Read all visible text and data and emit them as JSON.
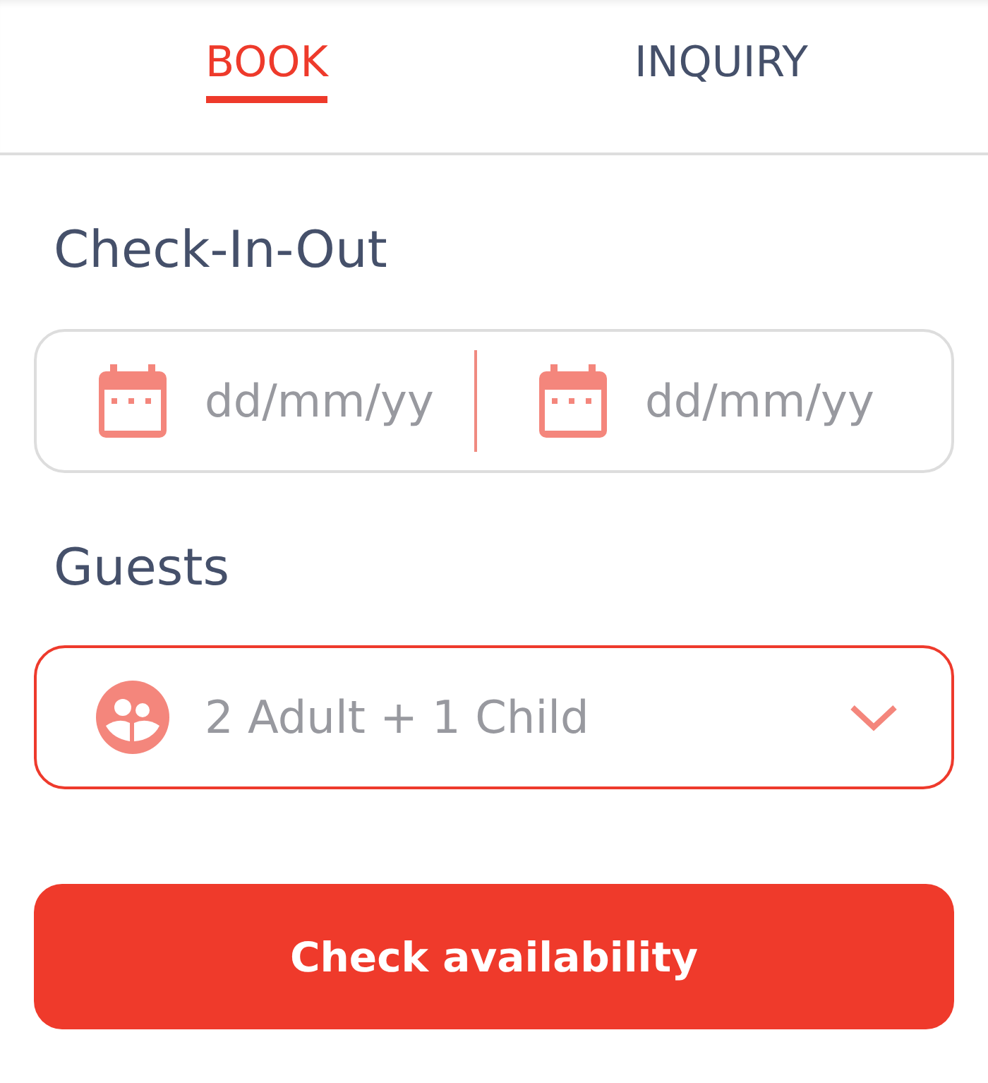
{
  "tabs": [
    {
      "label": "BOOK",
      "selected": true
    },
    {
      "label": "INQUIRY",
      "selected": false
    }
  ],
  "dates": {
    "label": "Check-In-Out",
    "focused": false,
    "fields": [
      {
        "placeholder": "dd/mm/yy"
      },
      {
        "placeholder": "dd/mm/yy"
      }
    ]
  },
  "guests": {
    "label": "Guests",
    "focused": true,
    "value": "2 Adult + 1 Child"
  },
  "submit_button": {
    "label": "Check availability"
  }
}
